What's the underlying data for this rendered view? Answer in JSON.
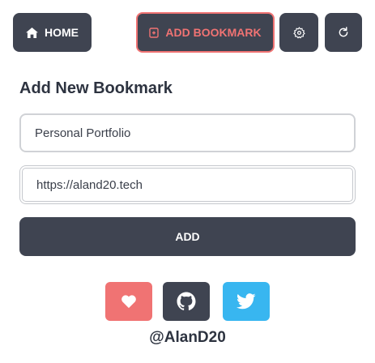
{
  "nav": {
    "home_label": "HOME",
    "add_bookmark_label": "ADD BOOKMARK"
  },
  "form": {
    "title": "Add New Bookmark",
    "name_value": "Personal Portfolio",
    "url_value": "https://aland20.tech",
    "submit_label": "ADD"
  },
  "footer": {
    "handle": "@AlanD20"
  },
  "colors": {
    "dark": "#3f4451",
    "accent": "#f07373",
    "twitter": "#38b6f0"
  },
  "icons": [
    "home-icon",
    "bookmark-icon",
    "gear-icon",
    "refresh-icon",
    "heart-icon",
    "github-icon",
    "twitter-icon"
  ]
}
